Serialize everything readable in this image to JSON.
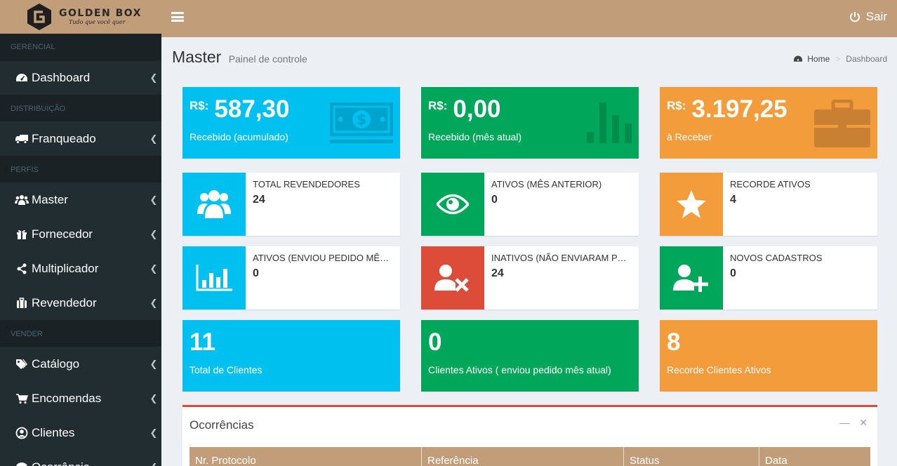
{
  "brand": {
    "name": "GOLDEN BOX",
    "tagline": "Tudo que você quer"
  },
  "header": {
    "logout_label": "Sair"
  },
  "sidebar": {
    "sections": [
      {
        "header": "GERENCIAL",
        "items": [
          {
            "label": "Dashboard",
            "icon": "dashboard-icon"
          }
        ]
      },
      {
        "header": "DISTRIBUIÇÃO",
        "items": [
          {
            "label": "Franqueado",
            "icon": "truck-icon"
          }
        ]
      },
      {
        "header": "PERFIS",
        "items": [
          {
            "label": "Master",
            "icon": "users-icon"
          },
          {
            "label": "Fornecedor",
            "icon": "gift-icon"
          },
          {
            "label": "Multiplicador",
            "icon": "share-icon"
          },
          {
            "label": "Revendedor",
            "icon": "suitcase-icon"
          }
        ]
      },
      {
        "header": "VENDER",
        "items": [
          {
            "label": "Catálogo",
            "icon": "tags-icon"
          },
          {
            "label": "Encomendas",
            "icon": "cart-icon"
          },
          {
            "label": "Clientes",
            "icon": "user-circle-icon"
          },
          {
            "label": "Ocorrência",
            "icon": "comment-icon"
          }
        ]
      }
    ]
  },
  "page": {
    "title": "Master",
    "subtitle": "Painel de controle"
  },
  "breadcrumb": {
    "home": "Home",
    "current": "Dashboard"
  },
  "colors": {
    "aqua": "#00c0ef",
    "green": "#00a65a",
    "orange": "#f39c3c",
    "red": "#dd4b39",
    "brand": "#c19e79",
    "sidebar": "#222d32"
  },
  "money_boxes": [
    {
      "currency": "R$:",
      "value": "587,30",
      "label": "Recebido (acumulado)",
      "icon": "money-icon"
    },
    {
      "currency": "R$:",
      "value": "0,00",
      "label": "Recebido (mês atual)",
      "icon": "bar-chart-icon"
    },
    {
      "currency": "R$:",
      "value": "3.197,25",
      "label": "à Receber",
      "icon": "briefcase-icon"
    }
  ],
  "info_boxes": [
    {
      "text": "TOTAL REVENDEDORES",
      "number": "24",
      "icon": "users-icon"
    },
    {
      "text": "ATIVOS (MÊS ANTERIOR)",
      "number": "0",
      "icon": "eye-icon"
    },
    {
      "text": "RECORDE ATIVOS",
      "number": "4",
      "icon": "star-icon"
    },
    {
      "text": "ATIVOS (ENVIOU PEDIDO MÊS ANTERIOR)",
      "number": "0",
      "icon": "bar-chart-icon"
    },
    {
      "text": "INATIVOS (NÃO ENVIARAM PEDIDO)",
      "number": "24",
      "icon": "user-times-icon"
    },
    {
      "text": "NOVOS CADASTROS",
      "number": "0",
      "icon": "user-plus-icon"
    }
  ],
  "count_boxes": [
    {
      "value": "11",
      "label": "Total de Clientes"
    },
    {
      "value": "0",
      "label": "Clientes Ativos ( enviou pedido mês atual)"
    },
    {
      "value": "8",
      "label": "Recorde Clientes Ativos"
    }
  ],
  "occurrences": {
    "title": "Ocorrências",
    "columns": [
      "Nr. Protocolo",
      "Referência",
      "Status",
      "Data"
    ]
  }
}
